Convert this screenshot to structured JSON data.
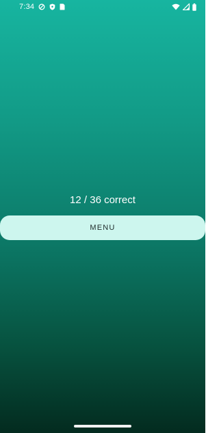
{
  "status_bar": {
    "time": "7:34",
    "left_icons": [
      "location-shield-icon",
      "security-shield-icon",
      "sim-card-icon"
    ],
    "right_icons": [
      "wifi-icon",
      "signal-icon",
      "battery-icon"
    ]
  },
  "result": {
    "score_text": "12 / 36 correct"
  },
  "menu_button": {
    "label": "MENU"
  },
  "colors": {
    "gradient_top": "#17b5a0",
    "gradient_bottom": "#032b1f",
    "button_bg": "#cdf6ee",
    "button_text": "#1f2b2a"
  }
}
